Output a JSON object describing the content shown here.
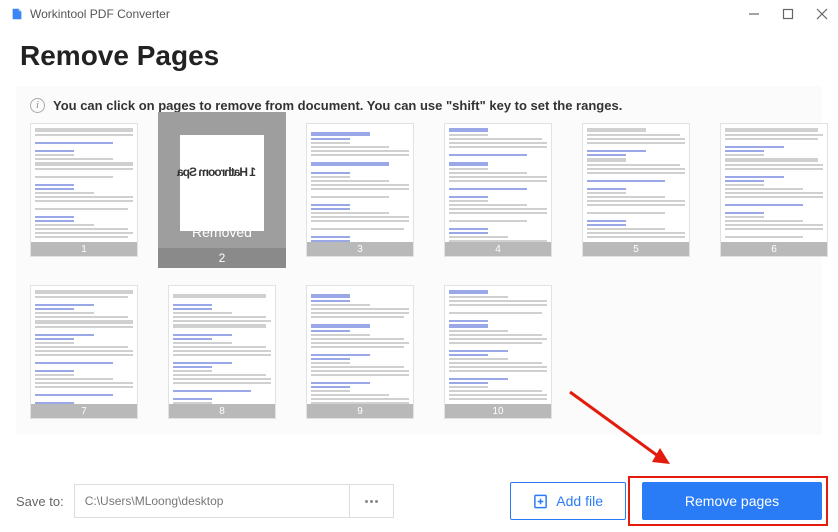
{
  "app": {
    "title": "Workintool PDF Converter"
  },
  "page": {
    "heading": "Remove Pages",
    "hint": "You can click on pages to remove from document. You can use \"shift\" key to set the ranges."
  },
  "thumbnails": [
    {
      "page": "1",
      "removed": false
    },
    {
      "page": "2",
      "removed": true,
      "removed_label": "Removed"
    },
    {
      "page": "3",
      "removed": false
    },
    {
      "page": "4",
      "removed": false
    },
    {
      "page": "5",
      "removed": false
    },
    {
      "page": "6",
      "removed": false
    },
    {
      "page": "7",
      "removed": false
    },
    {
      "page": "8",
      "removed": false
    },
    {
      "page": "9",
      "removed": false
    },
    {
      "page": "10",
      "removed": false
    }
  ],
  "save": {
    "label": "Save to:",
    "path": "C:\\Users\\MLoong\\desktop"
  },
  "buttons": {
    "add_file": "Add file",
    "remove_pages": "Remove pages"
  }
}
